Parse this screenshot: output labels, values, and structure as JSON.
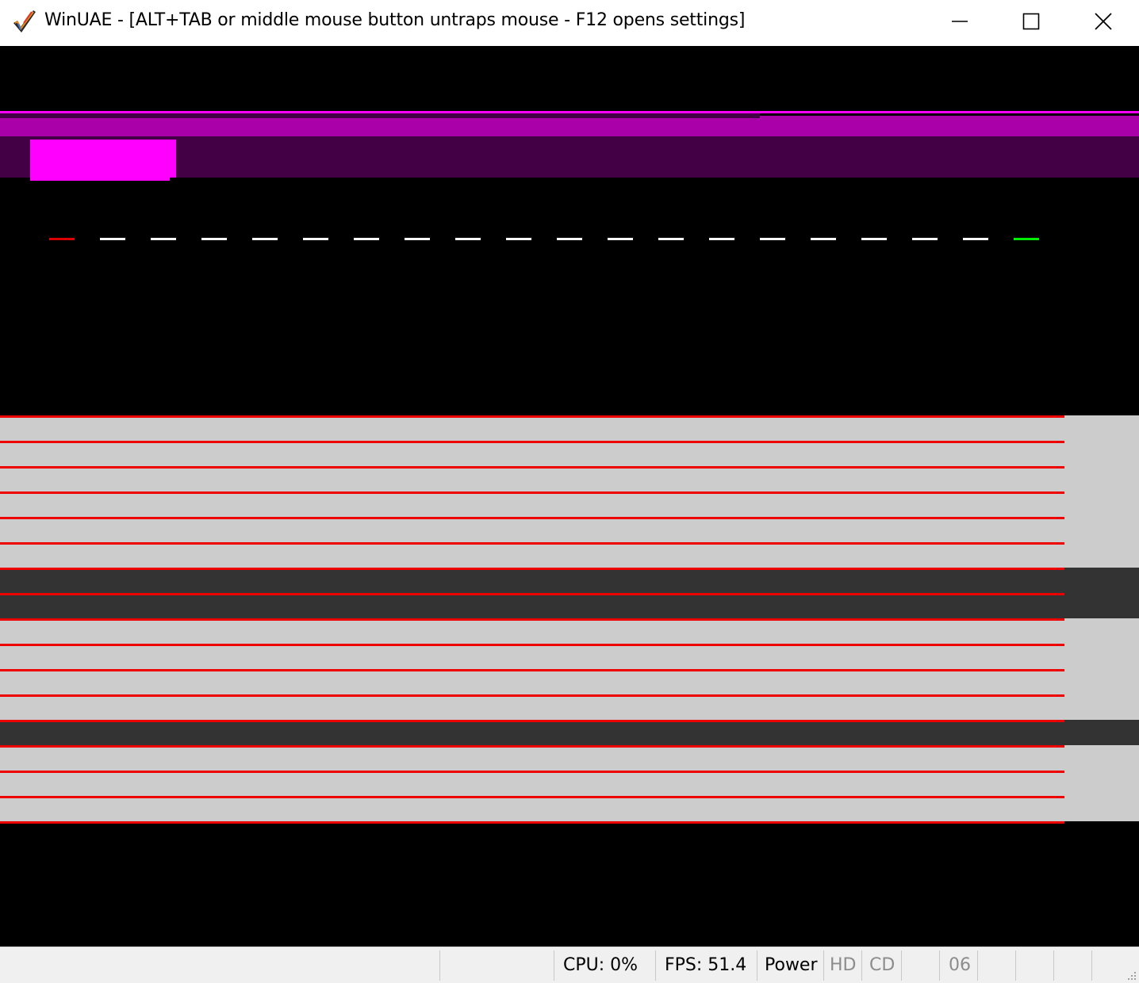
{
  "window": {
    "title": "WinUAE - [ALT+TAB or middle mouse button untraps mouse - F12 opens settings]",
    "app_icon": "winuae-checkmark-icon",
    "controls": {
      "minimize": "minimize-icon",
      "maximize": "maximize-icon",
      "close": "close-icon"
    }
  },
  "emulator_screen": {
    "background": "#000000",
    "colors": {
      "magenta_bright": "#ff00ff",
      "magenta_mid": "#aa00aa",
      "magenta_dark": "#440044",
      "stripe_light": "#cccccc",
      "stripe_dark": "#333333",
      "stripe_line": "#ee0000",
      "marker_red": "#dd0000",
      "marker_white": "#ffffff",
      "marker_green": "#00ee00"
    },
    "marker_row": [
      "red",
      "white",
      "white",
      "white",
      "white",
      "white",
      "white",
      "white",
      "white",
      "white",
      "white",
      "white",
      "white",
      "white",
      "white",
      "white",
      "white",
      "white",
      "white",
      "green"
    ],
    "stripe_rows": [
      "light",
      "light",
      "light",
      "light",
      "light",
      "light",
      "dark",
      "dark",
      "light",
      "light",
      "light",
      "light",
      "dark",
      "light",
      "light",
      "light"
    ]
  },
  "statusbar": {
    "cpu": "CPU: 0%",
    "fps": "FPS: 51.4",
    "power": "Power",
    "hd": "HD",
    "cd": "CD",
    "drive": "06"
  }
}
